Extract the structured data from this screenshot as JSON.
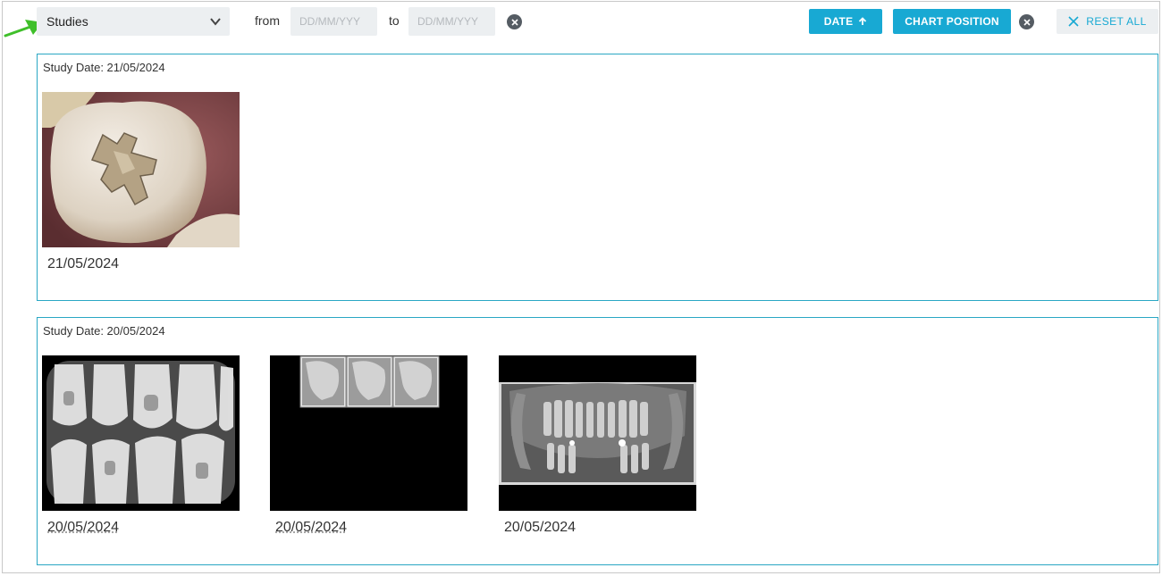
{
  "toolbar": {
    "view_select": {
      "value": "Studies"
    },
    "from_label": "from",
    "to_label": "to",
    "date_placeholder": "DD/MM/YYY",
    "sort_date_label": "DATE",
    "chart_position_label": "CHART POSITION",
    "reset_all_label": "RESET ALL"
  },
  "groups": [
    {
      "title": "Study Date: 21/05/2024",
      "items": [
        {
          "date": "21/05/2024",
          "kind": "intraoral-photo"
        }
      ]
    },
    {
      "title": "Study Date: 20/05/2024",
      "items": [
        {
          "date": "20/05/2024",
          "kind": "bitewing-xray"
        },
        {
          "date": "20/05/2024",
          "kind": "cephalometric-xray-series"
        },
        {
          "date": "20/05/2024",
          "kind": "panoramic-xray"
        }
      ]
    }
  ],
  "colors": {
    "accent": "#18a9d3",
    "border": "#2aa7c4",
    "input_bg": "#eceff1",
    "annotation_arrow": "#3fbf2a"
  }
}
